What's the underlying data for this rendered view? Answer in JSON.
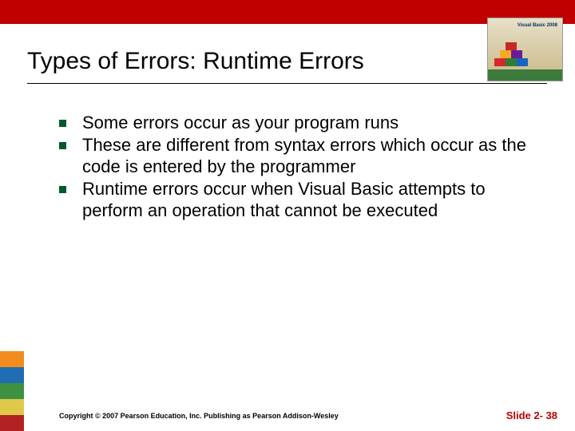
{
  "slide": {
    "title": "Types of Errors: Runtime Errors",
    "bullets": [
      "Some errors occur as your program runs",
      "These are different from syntax errors which occur as the code is entered by the programmer",
      "Runtime errors occur when Visual Basic attempts to perform an operation that cannot be executed"
    ],
    "copyright": "Copyright © 2007 Pearson Education, Inc. Publishing as Pearson Addison-Wesley",
    "slide_number": "Slide 2- 38",
    "book_logo": "Visual Basic 2008"
  }
}
